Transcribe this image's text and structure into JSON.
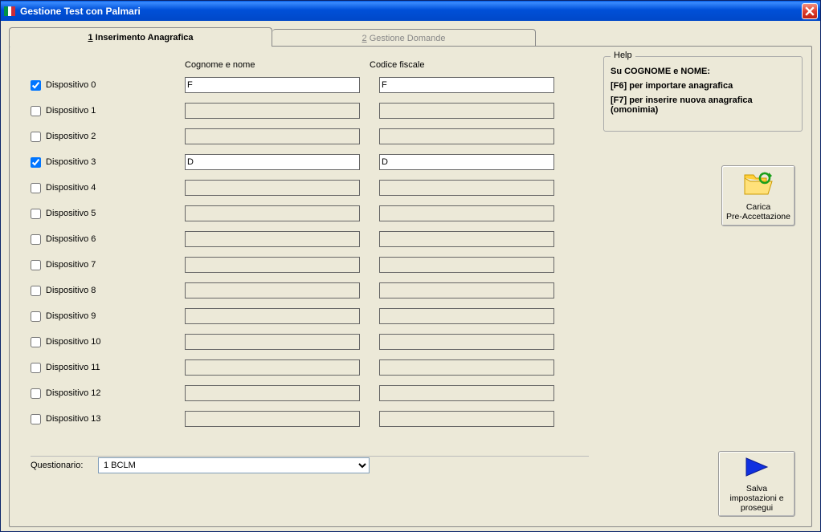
{
  "window": {
    "title": "Gestione Test con Palmari"
  },
  "tabs": [
    {
      "prefix": "1",
      "label": "Inserimento Anagrafica",
      "active": true
    },
    {
      "prefix": "2",
      "label": "Gestione Domande",
      "active": false
    }
  ],
  "headers": {
    "name": "Cognome e nome",
    "fiscal": "Codice fiscale"
  },
  "devices": [
    {
      "label": "Dispositivo 0",
      "checked": true,
      "name_val": "F",
      "fiscal_val": "F"
    },
    {
      "label": "Dispositivo 1",
      "checked": false,
      "name_val": "",
      "fiscal_val": ""
    },
    {
      "label": "Dispositivo 2",
      "checked": false,
      "name_val": "",
      "fiscal_val": ""
    },
    {
      "label": "Dispositivo 3",
      "checked": true,
      "name_val": "D",
      "fiscal_val": "D"
    },
    {
      "label": "Dispositivo 4",
      "checked": false,
      "name_val": "",
      "fiscal_val": ""
    },
    {
      "label": "Dispositivo 5",
      "checked": false,
      "name_val": "",
      "fiscal_val": ""
    },
    {
      "label": "Dispositivo 6",
      "checked": false,
      "name_val": "",
      "fiscal_val": ""
    },
    {
      "label": "Dispositivo 7",
      "checked": false,
      "name_val": "",
      "fiscal_val": ""
    },
    {
      "label": "Dispositivo 8",
      "checked": false,
      "name_val": "",
      "fiscal_val": ""
    },
    {
      "label": "Dispositivo 9",
      "checked": false,
      "name_val": "",
      "fiscal_val": ""
    },
    {
      "label": "Dispositivo 10",
      "checked": false,
      "name_val": "",
      "fiscal_val": ""
    },
    {
      "label": "Dispositivo 11",
      "checked": false,
      "name_val": "",
      "fiscal_val": ""
    },
    {
      "label": "Dispositivo 12",
      "checked": false,
      "name_val": "",
      "fiscal_val": ""
    },
    {
      "label": "Dispositivo 13",
      "checked": false,
      "name_val": "",
      "fiscal_val": ""
    }
  ],
  "help": {
    "legend": "Help",
    "line1": "Su COGNOME e NOME:",
    "line2": "[F6] per importare anagrafica",
    "line3": "[F7] per inserire nuova anagrafica (omonimia)"
  },
  "buttons": {
    "carica": "Carica\nPre-Accettazione",
    "prosegui": "Salva impostazioni e prosegui"
  },
  "questionario": {
    "label": "Questionario:",
    "selected": "1 BCLM"
  }
}
